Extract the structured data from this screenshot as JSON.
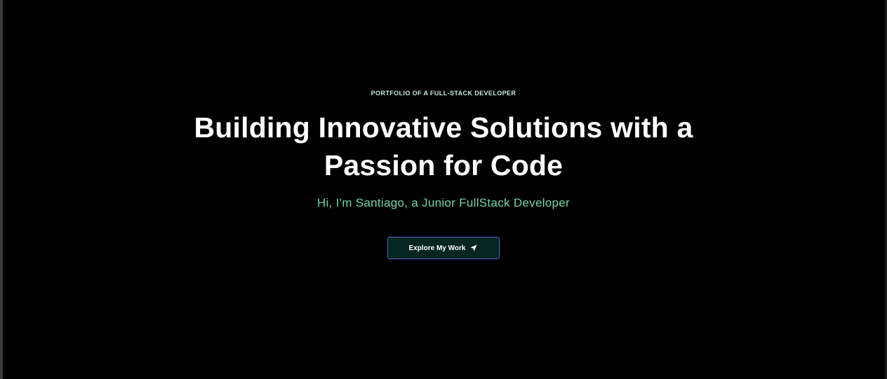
{
  "hero": {
    "eyebrow": "PORTFOLIO OF A FULL-STACK DEVELOPER",
    "headline": "Building Innovative Solutions with a Passion for Code",
    "subtitle": "Hi, I'm Santiago, a Junior FullStack Developer",
    "cta": {
      "label": "Explore My Work",
      "icon": "send-arrow-icon"
    }
  },
  "colors": {
    "background": "#000000",
    "headline": "#ffffff",
    "subtitle": "#6fd6a6",
    "cta_background": "#052520",
    "cta_border": "#5a5fd6"
  }
}
